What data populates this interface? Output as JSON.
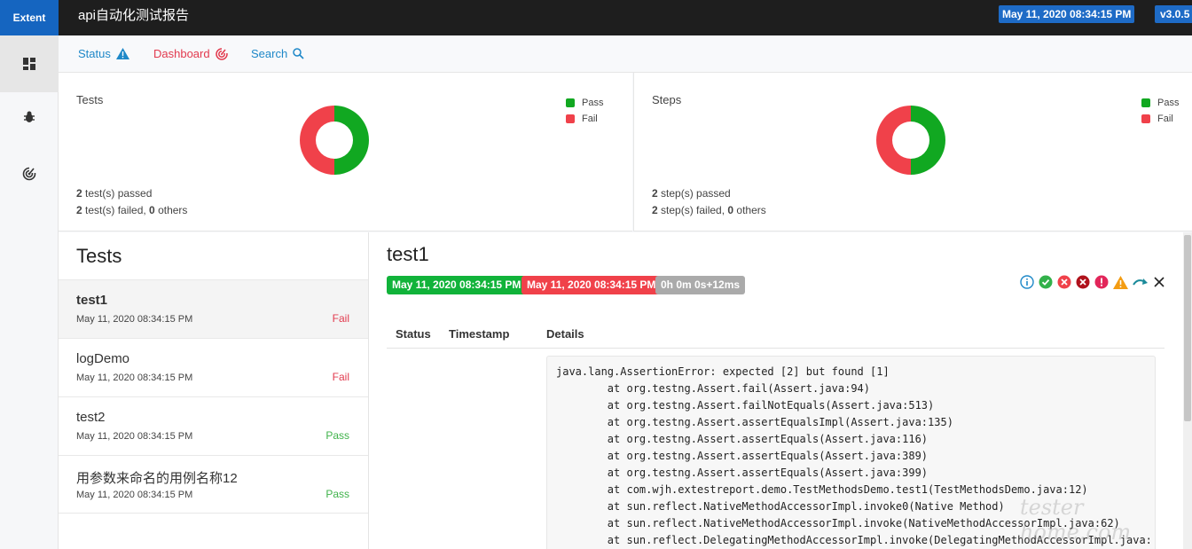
{
  "header": {
    "brand": "Extent",
    "title": "api自动化测试报告",
    "date": "May 11, 2020 08:34:15 PM",
    "version": "v3.0.5"
  },
  "sidebar": {
    "items": [
      {
        "icon": "dashboard-icon"
      },
      {
        "icon": "bug-icon"
      },
      {
        "icon": "radar-icon"
      }
    ]
  },
  "nav": {
    "status": "Status",
    "dashboard": "Dashboard",
    "search": "Search"
  },
  "colors": {
    "pass": "#11a821",
    "fail": "#f0414a",
    "skip": "#a8a8a8",
    "link_blue": "#1e88c8",
    "link_red": "#e23a4e"
  },
  "summary": {
    "tests": {
      "title": "Tests",
      "legend": [
        "Pass",
        "Fail"
      ],
      "passed": "2",
      "passed_label": " test(s) passed",
      "failed": "2",
      "failed_label": " test(s) failed, ",
      "others": "0",
      "others_label": " others"
    },
    "steps": {
      "title": "Steps",
      "legend": [
        "Pass",
        "Fail"
      ],
      "passed": "2",
      "passed_label": " step(s) passed",
      "failed": "2",
      "failed_label": " step(s) failed, ",
      "others": "0",
      "others_label": " others"
    }
  },
  "chart_data": [
    {
      "type": "pie",
      "title": "Tests",
      "categories": [
        "Pass",
        "Fail"
      ],
      "values": [
        2,
        2
      ]
    },
    {
      "type": "pie",
      "title": "Steps",
      "categories": [
        "Pass",
        "Fail"
      ],
      "values": [
        2,
        2
      ]
    }
  ],
  "tests_list": {
    "heading": "Tests",
    "items": [
      {
        "name": "test1",
        "time": "May 11, 2020 08:34:15 PM",
        "status": "Fail"
      },
      {
        "name": "logDemo",
        "time": "May 11, 2020 08:34:15 PM",
        "status": "Fail"
      },
      {
        "name": "test2",
        "time": "May 11, 2020 08:34:15 PM",
        "status": "Pass"
      },
      {
        "name": "用参数来命名的用例名称12",
        "time": "May 11, 2020 08:34:15 PM",
        "status": "Pass"
      }
    ]
  },
  "detail": {
    "title": "test1",
    "start": "May 11, 2020 08:34:15 PM",
    "end": "May 11, 2020 08:34:15 PM",
    "duration": "0h 0m 0s+12ms",
    "columns": [
      "Status",
      "Timestamp",
      "Details"
    ],
    "stack_trace": "java.lang.AssertionError: expected [2] but found [1]\n\tat org.testng.Assert.fail(Assert.java:94)\n\tat org.testng.Assert.failNotEquals(Assert.java:513)\n\tat org.testng.Assert.assertEqualsImpl(Assert.java:135)\n\tat org.testng.Assert.assertEquals(Assert.java:116)\n\tat org.testng.Assert.assertEquals(Assert.java:389)\n\tat org.testng.Assert.assertEquals(Assert.java:399)\n\tat com.wjh.extestreport.demo.TestMethodsDemo.test1(TestMethodsDemo.java:12)\n\tat sun.reflect.NativeMethodAccessorImpl.invoke0(Native Method)\n\tat sun.reflect.NativeMethodAccessorImpl.invoke(NativeMethodAccessorImpl.java:62)\n\tat sun.reflect.DelegatingMethodAccessorImpl.invoke(DelegatingMethodAccessorImpl.java:"
  },
  "watermark": "tester home.com"
}
